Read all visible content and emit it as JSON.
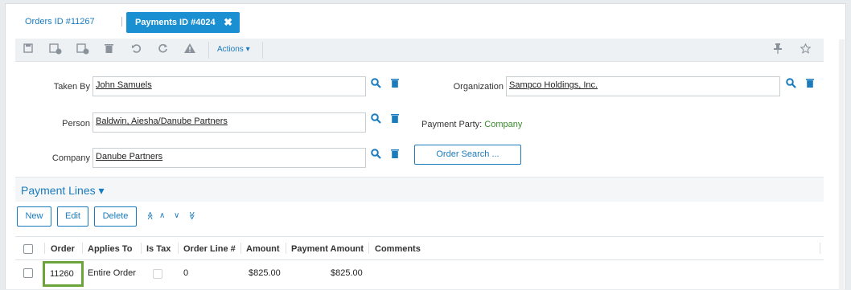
{
  "tabs": {
    "orders": "Orders ID #11267",
    "payments": "Payments ID #4024",
    "close_glyph": "✖"
  },
  "toolbar": {
    "actions_label": "Actions ▾",
    "icons": [
      "save-icon",
      "save-close-icon",
      "save-new-icon",
      "delete-icon",
      "undo-icon",
      "refresh-icon",
      "warning-icon",
      "pin-icon",
      "star-icon"
    ]
  },
  "form": {
    "taken_by_label": "Taken By",
    "taken_by_value": "John Samuels",
    "person_label": "Person",
    "person_value": "Baldwin, Aiesha/Danube Partners",
    "company_label": "Company",
    "company_value": "Danube Partners",
    "organization_label": "Organization",
    "organization_value": "Sampco Holdings, Inc.",
    "payment_party_label": "Payment Party:",
    "payment_party_value": "Company",
    "order_search_label": "Order Search ..."
  },
  "payment_lines": {
    "title": "Payment Lines ▾",
    "buttons": {
      "new": "New",
      "edit": "Edit",
      "delete": "Delete"
    },
    "arrows": {
      "top": "≪",
      "up": "∧",
      "down": "∨",
      "bottom": "≫"
    },
    "columns": [
      "Order",
      "Applies To",
      "Is Tax",
      "Order Line #",
      "Amount",
      "Payment Amount",
      "Comments"
    ],
    "rows": [
      {
        "order": "11260",
        "applies_to": "Entire Order",
        "order_line": "0",
        "amount": "$825.00",
        "payment_amount": "$825.00",
        "comments": ""
      }
    ]
  },
  "colors": {
    "accent": "#1a8fd1",
    "link": "#1a7bbd",
    "highlight": "#6aa43a",
    "party_value": "#3a8b2c"
  }
}
